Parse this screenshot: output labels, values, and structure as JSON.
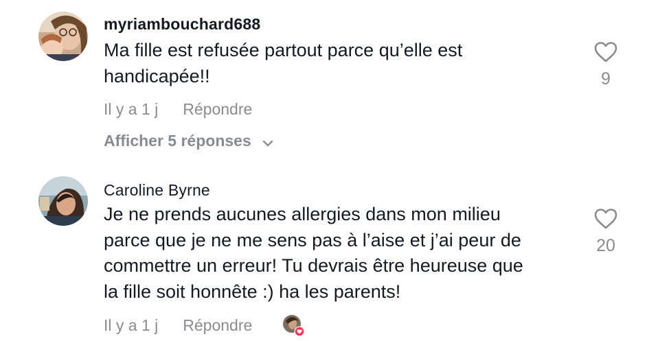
{
  "comments": [
    {
      "username": "myriambouchard688",
      "text_lines": [
        "Ma fille est refusée partout parce qu’elle est",
        "handicapée!!"
      ],
      "time": "Il y a 1 j",
      "reply_label": "Répondre",
      "view_replies": "Afficher 5 réponses",
      "like_count": "9",
      "icons": {
        "like": "heart-outline-icon",
        "expand": "chevron-down-icon"
      }
    },
    {
      "username": "Caroline Byrne",
      "text_lines": [
        "Je ne prends aucunes allergies dans mon milieu",
        "parce que je ne me sens pas à l’aise et j’ai peur de",
        "commettre un erreur! Tu devrais être heureuse que",
        "la fille soit honnête :) ha les parents!"
      ],
      "time": "Il y a 1 j",
      "reply_label": "Répondre",
      "like_count": "20",
      "icons": {
        "like": "heart-outline-icon",
        "creator_liked": "creator-liked-heart-badge-icon"
      }
    }
  ],
  "colors": {
    "text": "#161823",
    "muted": "#8a8b91",
    "like_badge": "#fe2c55",
    "background": "#ffffff"
  }
}
